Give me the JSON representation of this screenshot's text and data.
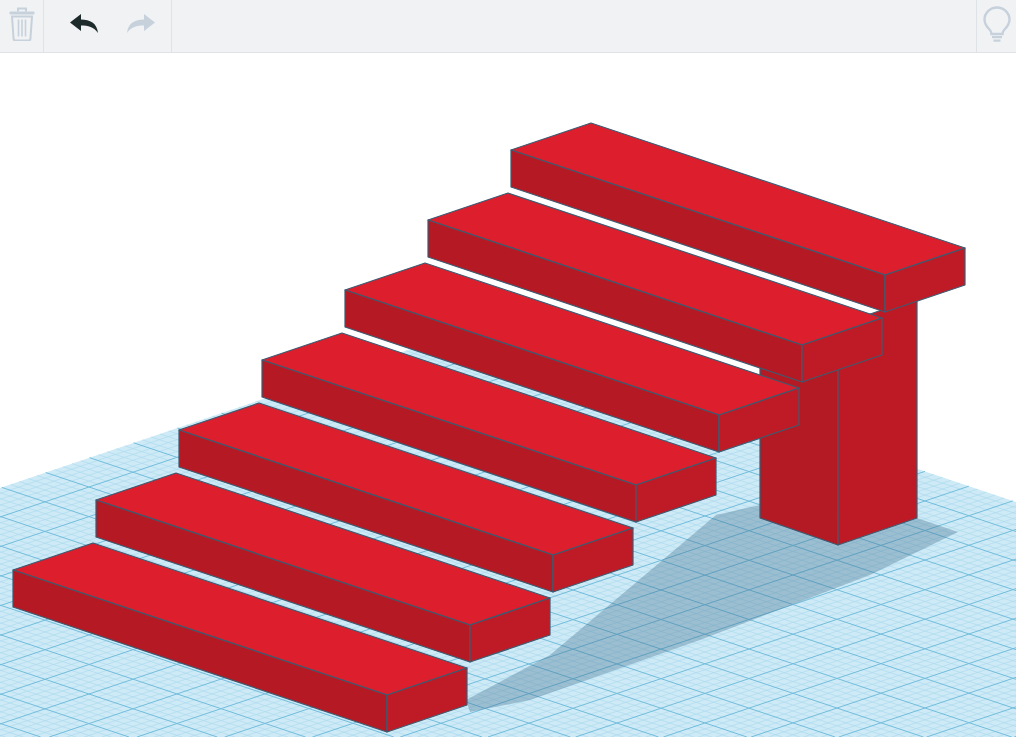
{
  "toolbar": {
    "left_tools": [
      {
        "kind": "delete",
        "disabled": true
      }
    ],
    "history_tools": [
      {
        "kind": "undo",
        "disabled": false
      },
      {
        "kind": "redo",
        "disabled": true
      }
    ],
    "right_tools": [
      {
        "kind": "hint",
        "disabled": true
      }
    ]
  }
}
